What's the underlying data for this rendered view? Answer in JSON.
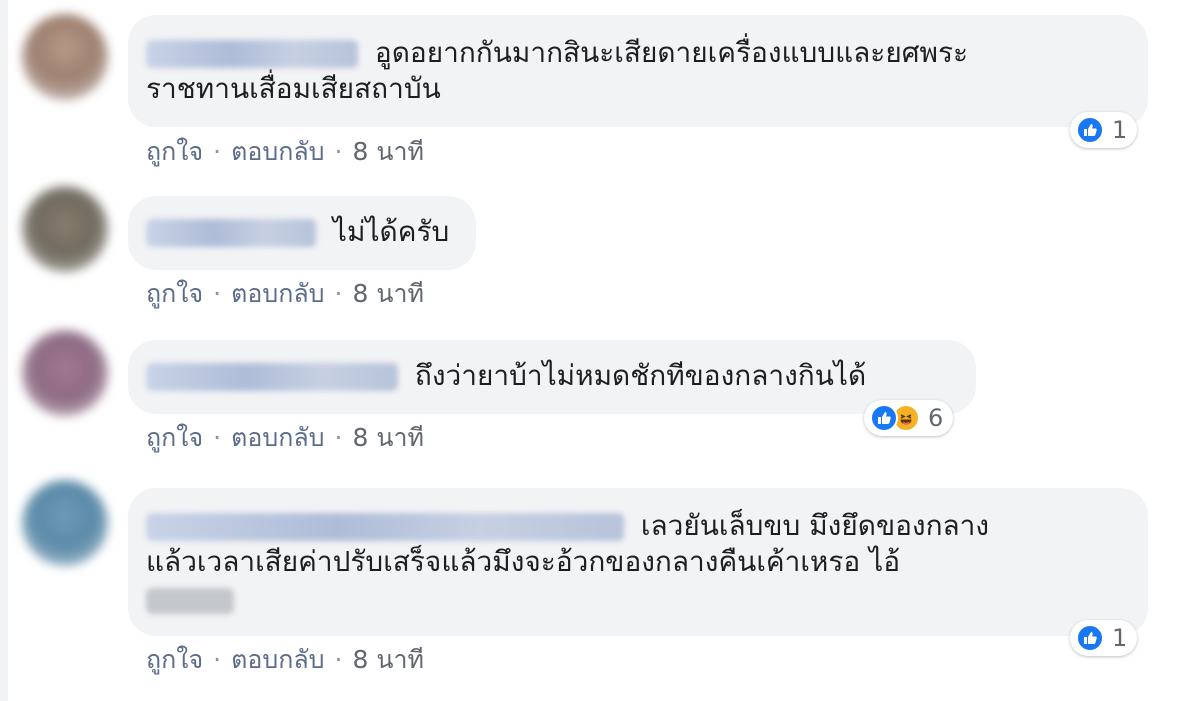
{
  "comments": [
    {
      "text_line1": "อูดอยากกันมากสินะเสียดายเครื่องแบบและยศพระ",
      "text_line2": "ราชทานเสื่อมเสียสถาบัน",
      "like_label": "ถูกใจ",
      "reply_label": "ตอบกลับ",
      "time": "8 นาที",
      "reaction_count": "1",
      "reactions": [
        "like-icon"
      ]
    },
    {
      "text_line1": "ไม่ได้ครับ",
      "like_label": "ถูกใจ",
      "reply_label": "ตอบกลับ",
      "time": "8 นาที"
    },
    {
      "text_line1": "ถึงว่ายาบ้าไม่หมดชักทีของกลางกินได้",
      "like_label": "ถูกใจ",
      "reply_label": "ตอบกลับ",
      "time": "8 นาที",
      "reaction_count": "6",
      "reactions": [
        "like-icon",
        "haha-icon"
      ]
    },
    {
      "text_line1": "เลวยันเล็บขบ มึงยึดของกลาง",
      "text_line2": "แล้วเวลาเสียค่าปรับเสร็จแล้วมึงจะอ้วกของกลางคืนเค้าเหรอ ไอ้",
      "like_label": "ถูกใจ",
      "reply_label": "ตอบกลับ",
      "time": "8 นาที",
      "reaction_count": "1",
      "reactions": [
        "like-icon"
      ]
    }
  ],
  "separator": "·",
  "colors": {
    "bubble_bg": "#f2f3f5",
    "link": "#5d6c8a",
    "like_blue": "#1877f2",
    "haha_yellow": "#f7b125"
  }
}
